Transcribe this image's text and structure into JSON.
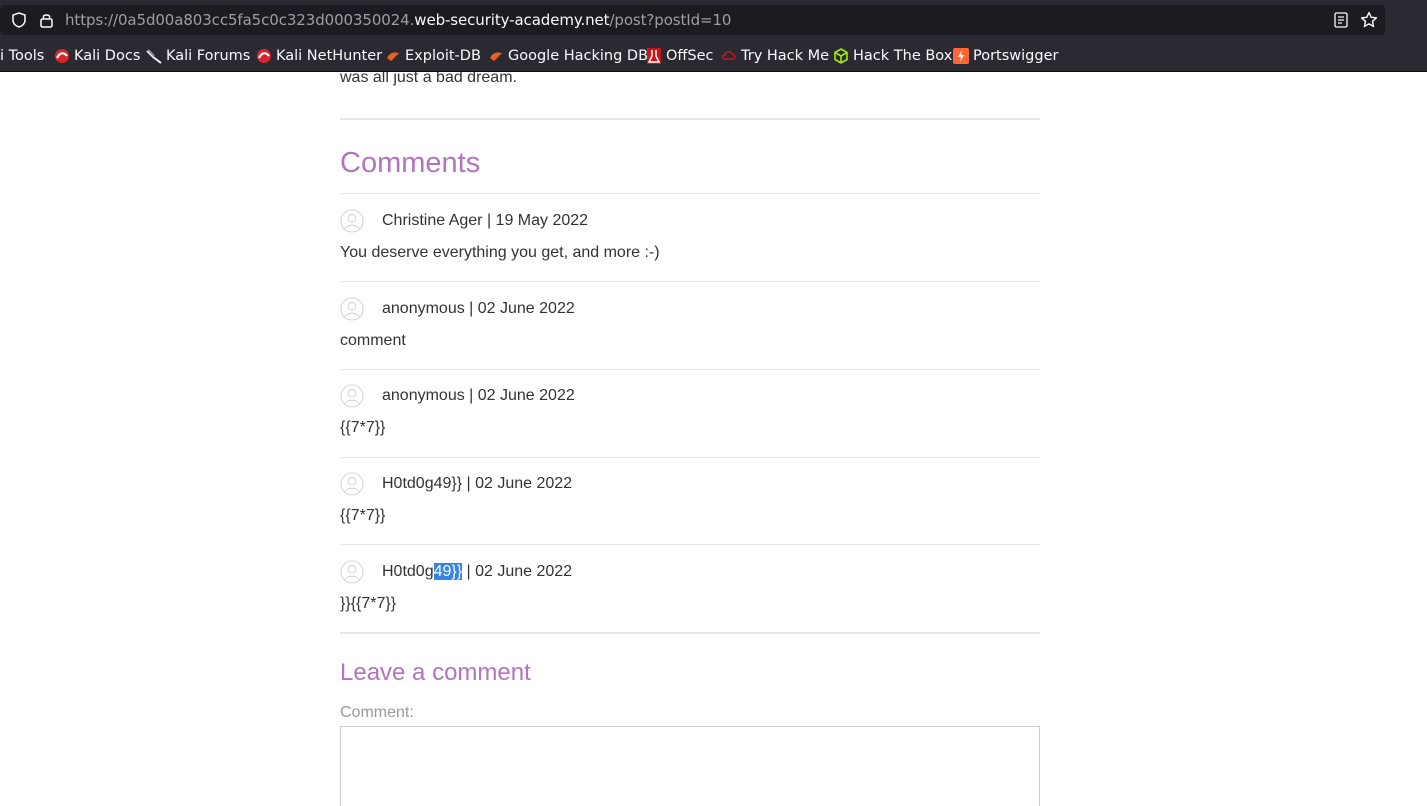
{
  "browser": {
    "url_prefix": "https://0a5d00a803cc5fa5c0c323d000350024.",
    "url_domain": "web-security-academy.net",
    "url_path": "/post?postId=10",
    "bookmarks": [
      {
        "label": "i Tools",
        "icon": "none"
      },
      {
        "label": "Kali Docs",
        "icon": "kali-docs-icon"
      },
      {
        "label": "Kali Forums",
        "icon": "kali-forums-icon"
      },
      {
        "label": "Kali NetHunter",
        "icon": "kali-nethunter-icon"
      },
      {
        "label": "Exploit-DB",
        "icon": "exploit-db-icon"
      },
      {
        "label": "Google Hacking DB",
        "icon": "ghdb-icon"
      },
      {
        "label": "OffSec",
        "icon": "offsec-icon"
      },
      {
        "label": "Try Hack Me",
        "icon": "tryhackme-icon"
      },
      {
        "label": "Hack The Box",
        "icon": "hackthebox-icon"
      },
      {
        "label": "Portswigger",
        "icon": "portswigger-icon"
      }
    ]
  },
  "post": {
    "trailing_text": "was all just a bad dream."
  },
  "comments": {
    "heading": "Comments",
    "items": [
      {
        "author": "Christine Ager",
        "separator": " | ",
        "date": "19 May 2022",
        "body": "You deserve everything you get, and more :-)"
      },
      {
        "author": "anonymous",
        "separator": " | ",
        "date": "02 June 2022",
        "body": "comment"
      },
      {
        "author": "anonymous",
        "separator": " | ",
        "date": "02 June 2022",
        "body": "{{7*7}}"
      },
      {
        "author": "H0td0g49}}",
        "separator": " | ",
        "date": "02 June 2022",
        "body": "{{7*7}}"
      },
      {
        "author_plain": "H0td0g",
        "author_selected": "49}}",
        "separator": " | ",
        "date": "02 June 2022",
        "body": "}}{{7*7}}"
      }
    ]
  },
  "leave_comment": {
    "heading": "Leave a comment",
    "comment_label": "Comment:",
    "comment_value": ""
  },
  "colors": {
    "accent": "#b473bf",
    "selection": "#3584e4",
    "toolbar": "#2b2a33"
  }
}
